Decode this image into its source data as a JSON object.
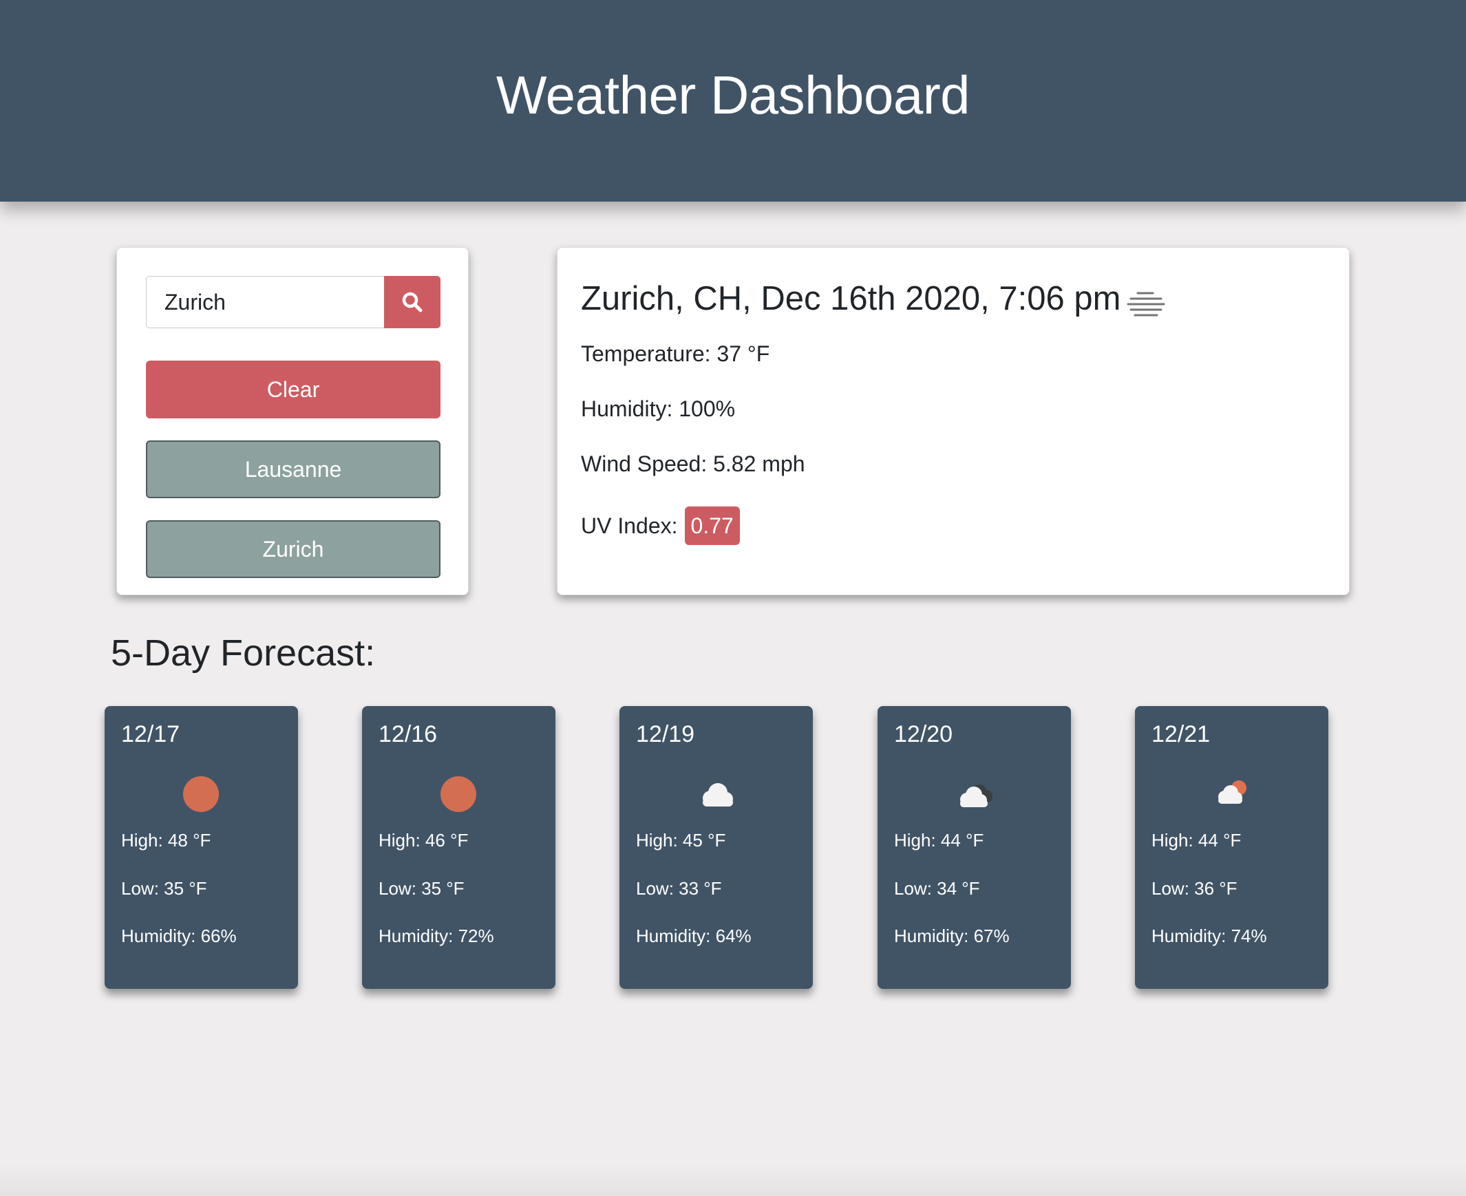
{
  "header": {
    "title": "Weather Dashboard"
  },
  "search": {
    "value": "Zurich",
    "button_icon": "search-icon",
    "clear_label": "Clear",
    "history": [
      "Lausanne",
      "Zurich"
    ]
  },
  "current": {
    "title": "Zurich, CH, Dec 16th 2020, 7:06 pm",
    "icon": "mist-icon",
    "temperature": "Temperature: 37 °F",
    "humidity": "Humidity: 100%",
    "wind": "Wind Speed: 5.82 mph",
    "uv_label": "UV Index:",
    "uv_value": "0.77"
  },
  "forecast": {
    "heading": "5-Day Forecast:",
    "days": [
      {
        "date": "12/17",
        "icon": "sun-icon",
        "high": "High: 48 °F",
        "low": "Low: 35 °F",
        "humidity": "Humidity: 66%"
      },
      {
        "date": "12/16",
        "icon": "sun-icon",
        "high": "High: 46 °F",
        "low": "Low: 35 °F",
        "humidity": "Humidity: 72%"
      },
      {
        "date": "12/19",
        "icon": "cloud-icon",
        "high": "High: 45 °F",
        "low": "Low: 33 °F",
        "humidity": "Humidity: 64%"
      },
      {
        "date": "12/20",
        "icon": "broken-clouds-icon",
        "high": "High: 44 °F",
        "low": "Low: 34 °F",
        "humidity": "Humidity: 67%"
      },
      {
        "date": "12/21",
        "icon": "partly-cloudy-icon",
        "high": "High: 44 °F",
        "low": "Low: 36 °F",
        "humidity": "Humidity: 74%"
      }
    ]
  },
  "colors": {
    "header_bg": "#415466",
    "accent_red": "#cd5c62",
    "history_btn": "#8da19e",
    "sun": "#e0714f",
    "page_bg": "#efeded"
  }
}
